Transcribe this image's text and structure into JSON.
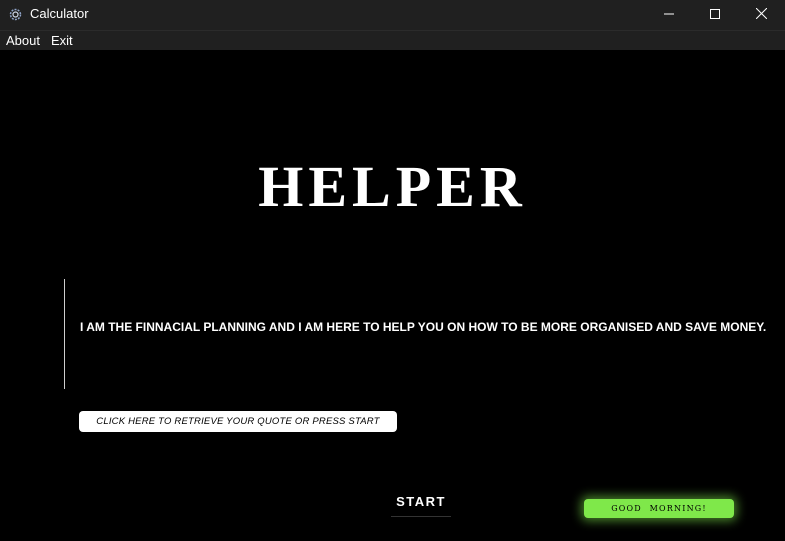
{
  "window": {
    "title": "Calculator",
    "icon": "gear-app-icon"
  },
  "menubar": {
    "items": [
      {
        "label": "About"
      },
      {
        "label": "Exit"
      }
    ]
  },
  "main": {
    "heading": "HELPER",
    "intro": "I AM THE FINNACIAL PLANNING AND I AM HERE TO HELP YOU ON HOW TO BE MORE ORGANISED AND SAVE MONEY.",
    "retrieve_button": "CLICK HERE TO RETRIEVE YOUR QUOTE OR PRESS START",
    "start_button": "START",
    "greeting": "GOOD MORNING!"
  },
  "colors": {
    "background": "#000000",
    "titlebar": "#202020",
    "greeting_accent": "#7fe84a"
  }
}
